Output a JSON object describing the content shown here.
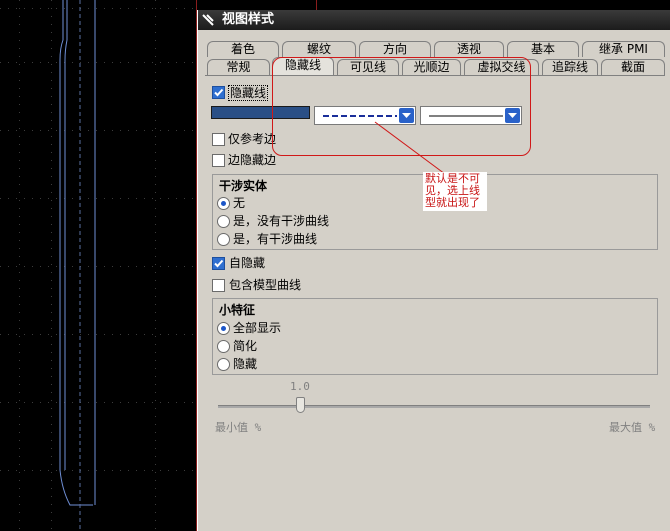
{
  "dialog": {
    "title": "视图样式"
  },
  "tabs_row1": [
    {
      "label": "着色"
    },
    {
      "label": "螺纹"
    },
    {
      "label": "方向"
    },
    {
      "label": "透视"
    },
    {
      "label": "基本"
    },
    {
      "label": "继承 PMI"
    }
  ],
  "tabs_row2": [
    {
      "label": "常规"
    },
    {
      "label": "隐藏线"
    },
    {
      "label": "可见线"
    },
    {
      "label": "光顺边"
    },
    {
      "label": "虚拟交线"
    },
    {
      "label": "追踪线"
    },
    {
      "label": "截面"
    }
  ],
  "hidden_line": {
    "checkbox_label": "隐藏线",
    "checked": true,
    "color": "#2a4f86",
    "font_style": "dashed",
    "width_style": "thin"
  },
  "ref_edges_only": {
    "label": "仅参考边",
    "checked": false
  },
  "edges_hidden": {
    "label": "边隐藏边",
    "checked": false
  },
  "interference": {
    "title": "干涉实体",
    "options": [
      {
        "label": "无",
        "selected": true
      },
      {
        "label": "是，没有干涉曲线",
        "selected": false
      },
      {
        "label": "是，有干涉曲线",
        "selected": false
      }
    ]
  },
  "self_hidden": {
    "label": "自隐藏",
    "checked": true
  },
  "include_model_curves": {
    "label": "包含模型曲线",
    "checked": false
  },
  "small_features": {
    "title": "小特征",
    "options": [
      {
        "label": "全部显示",
        "selected": true
      },
      {
        "label": "简化",
        "selected": false
      },
      {
        "label": "隐藏",
        "selected": false
      }
    ]
  },
  "slider": {
    "value_label": "1.0",
    "min_label": "最小值 %",
    "max_label": "最大值 %"
  },
  "annotation": {
    "text": "默认是不可见，选上线型就出现了",
    "color": "#c81414"
  }
}
